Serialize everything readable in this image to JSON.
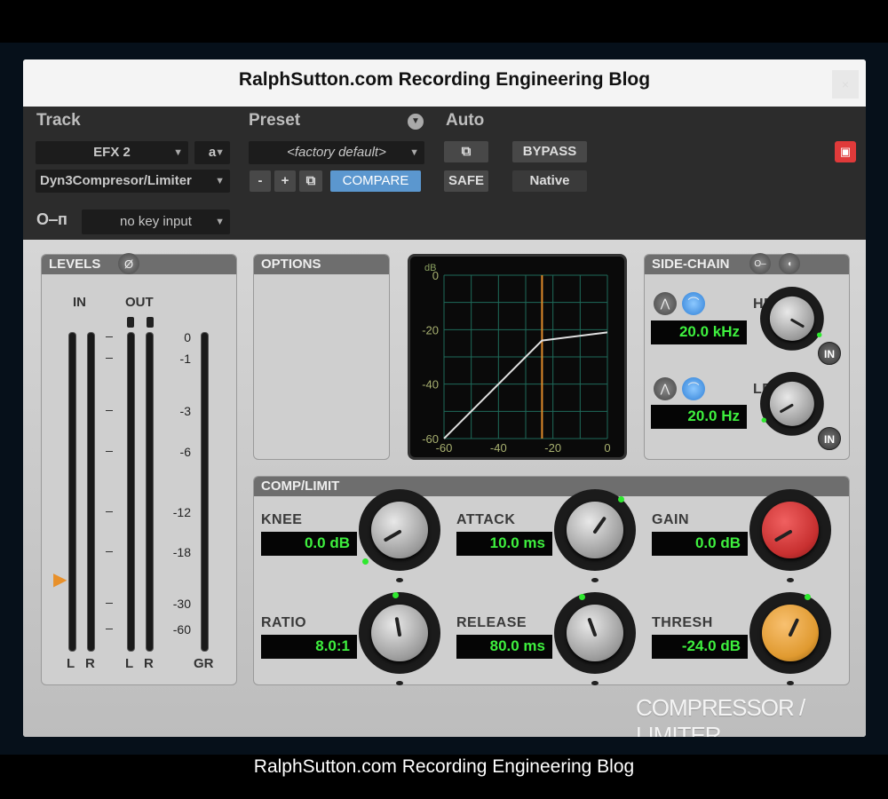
{
  "window_title": "RalphSutton.com Recording Engineering Blog",
  "footer_caption": "RalphSutton.com Recording Engineering Blog",
  "close_icon": "×",
  "header": {
    "track_label": "Track",
    "preset_label": "Preset",
    "auto_label": "Auto",
    "track_name": "EFX 2",
    "track_channel": "a",
    "plugin_name": "Dyn3Compresor/Limiter",
    "preset_name": "<factory default>",
    "minus": "-",
    "plus": "+",
    "compare": "COMPARE",
    "bypass": "BYPASS",
    "safe": "SAFE",
    "native": "Native",
    "key_input": "no key input",
    "compare_color": "#5b97cf",
    "power_color": "#e03a3a"
  },
  "levels": {
    "title": "LEVELS",
    "phase": "Ø",
    "in_label": "IN",
    "out_label": "OUT",
    "ticks": [
      "0",
      "-1",
      "-3",
      "-6",
      "-12",
      "-18",
      "-30",
      "-60"
    ],
    "channel_labels": [
      "L",
      "R",
      "L",
      "R",
      "GR"
    ]
  },
  "options": {
    "title": "OPTIONS"
  },
  "graph": {
    "type": "line",
    "unit": "dB",
    "x_ticks": [
      "-60",
      "-40",
      "-20",
      "0"
    ],
    "y_ticks": [
      "0",
      "-20",
      "-40",
      "-60"
    ],
    "xlim": [
      -60,
      0
    ],
    "ylim": [
      -60,
      0
    ],
    "threshold": -24,
    "ratio": 8,
    "curve": [
      [
        -60,
        -60
      ],
      [
        -24,
        -24
      ],
      [
        0,
        -21
      ]
    ],
    "threshold_color": "#e08a2a"
  },
  "sidechain": {
    "title": "SIDE-CHAIN",
    "hf_label": "HF",
    "hf_value": "20.0 kHz",
    "lf_label": "LF",
    "lf_value": "20.0 Hz",
    "in_label": "IN"
  },
  "comp": {
    "title": "COMP/LIMIT",
    "knee_label": "KNEE",
    "knee_value": "0.0 dB",
    "attack_label": "ATTACK",
    "attack_value": "10.0 ms",
    "gain_label": "GAIN",
    "gain_value": "0.0 dB",
    "ratio_label": "RATIO",
    "ratio_value": "8.0:1",
    "release_label": "RELEASE",
    "release_value": "80.0 ms",
    "thresh_label": "THRESH",
    "thresh_value": "-24.0 dB",
    "gain_knob_color": "#c83030",
    "thresh_knob_color": "#e09a30"
  },
  "logo": "COMPRESSOR / LIMITER"
}
